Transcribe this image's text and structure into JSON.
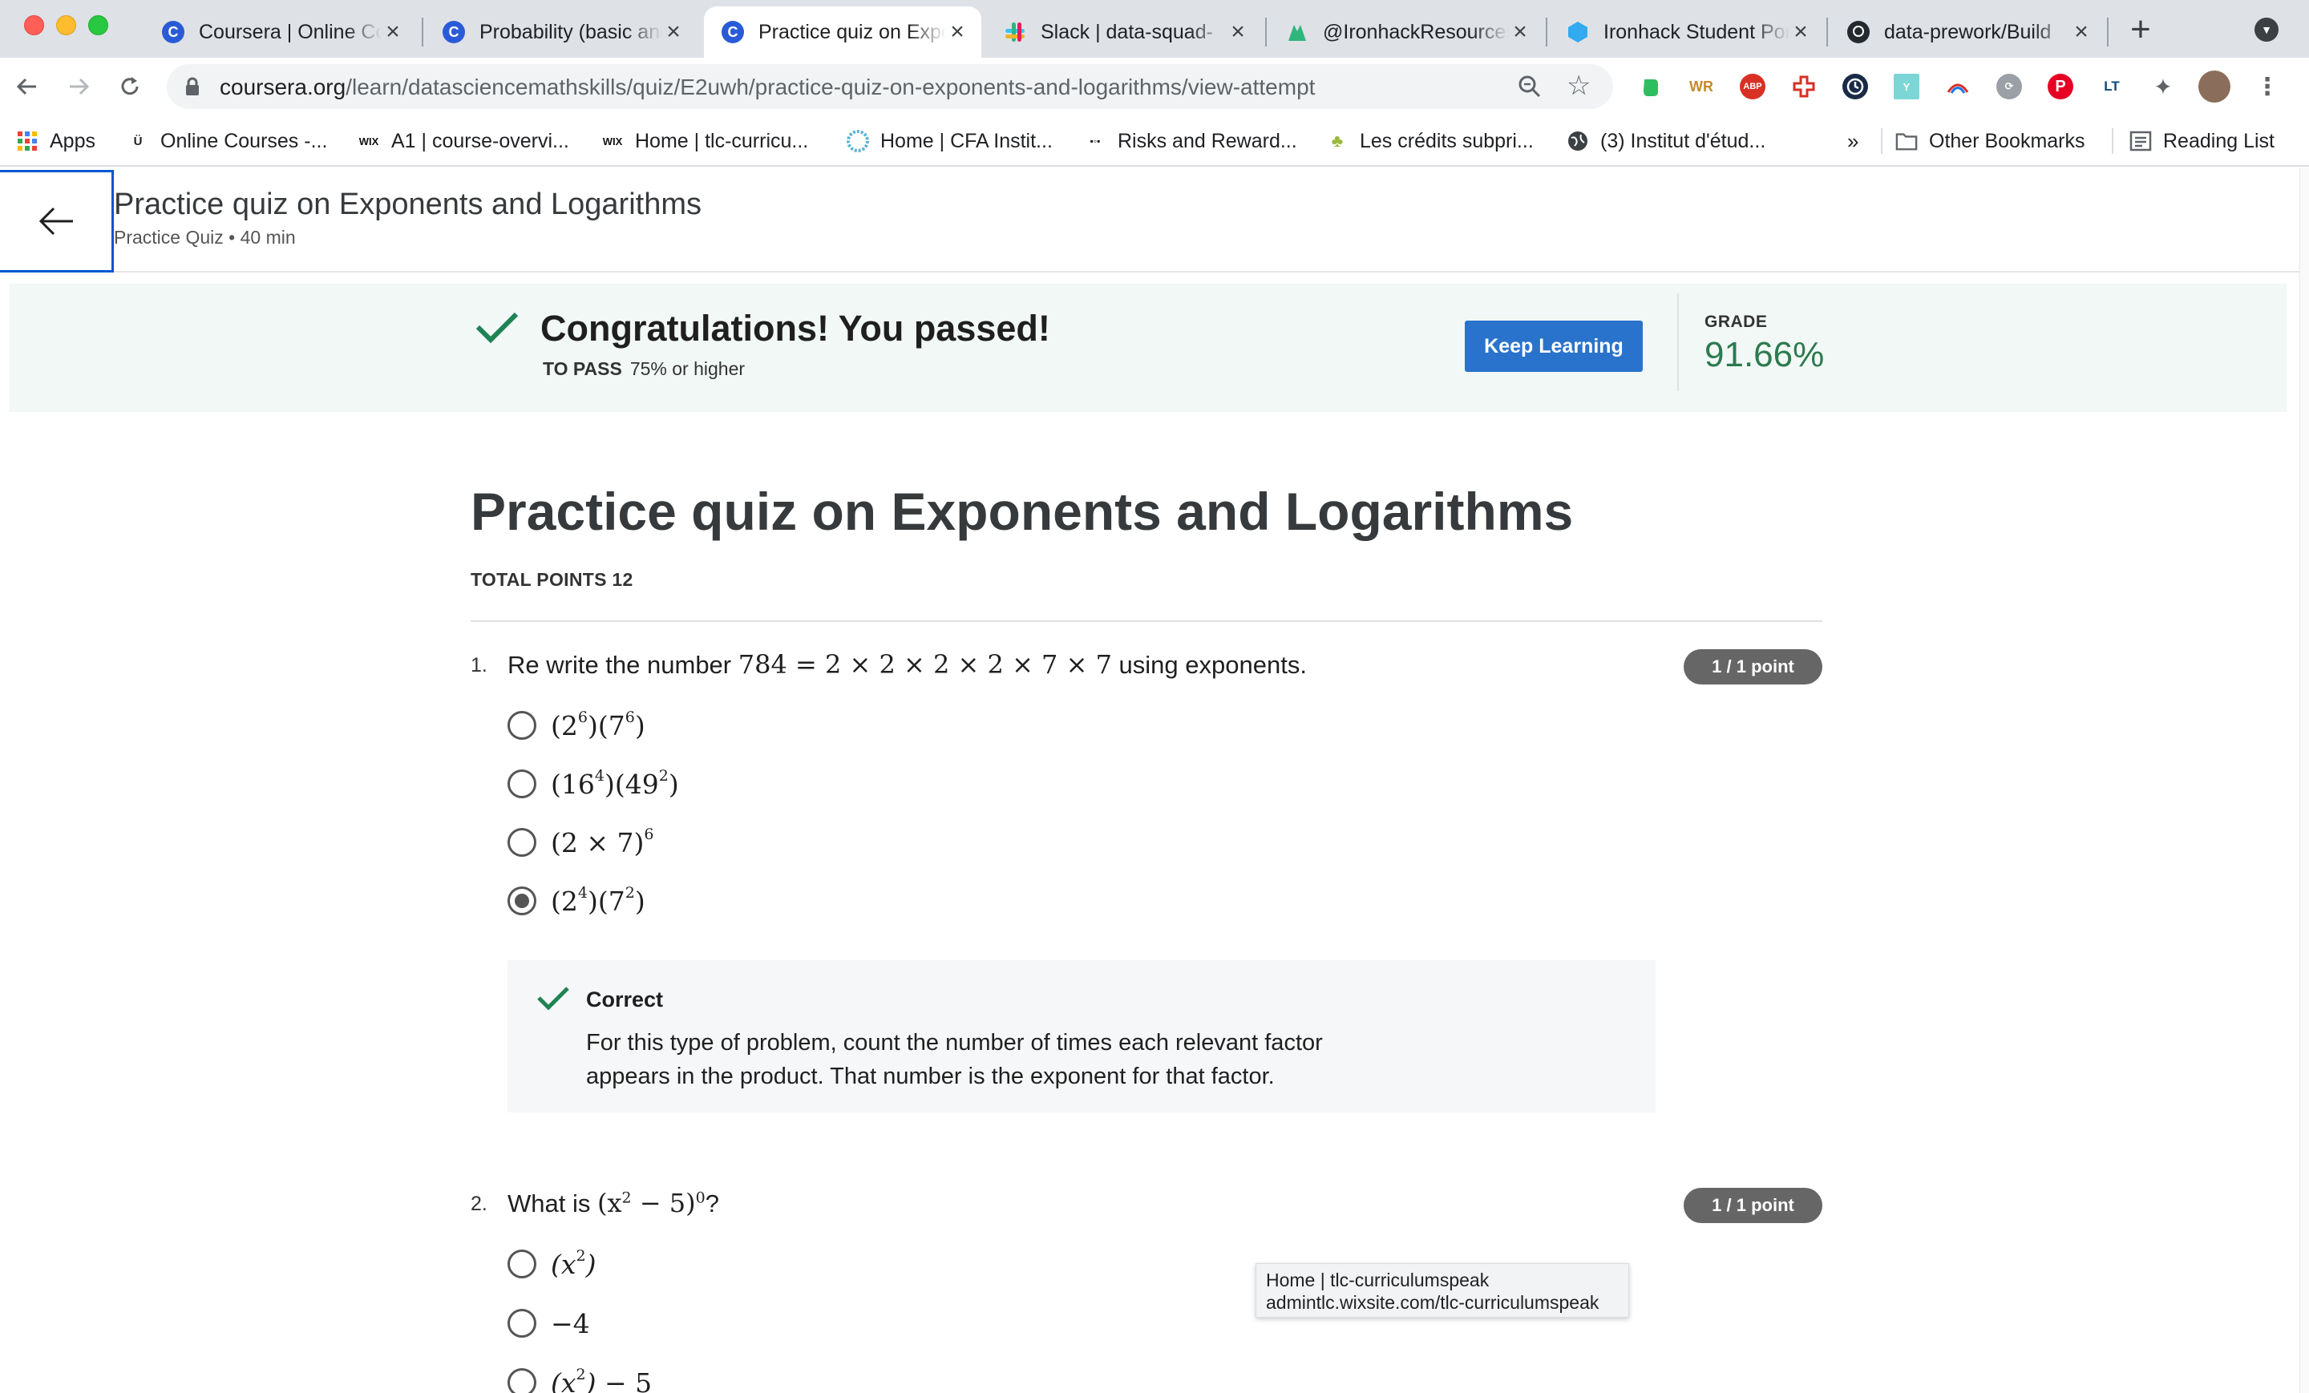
{
  "browser": {
    "tabs": [
      {
        "title": "Coursera | Online Courses",
        "favicon": "coursera-icon",
        "active": false
      },
      {
        "title": "Probability (basic and advanced)",
        "favicon": "coursera-icon",
        "active": false
      },
      {
        "title": "Practice quiz on Exponents and Logarithms",
        "favicon": "coursera-icon",
        "active": true
      },
      {
        "title": "Slack | data-squad-",
        "favicon": "slack-icon",
        "active": false
      },
      {
        "title": "@IronhackResources",
        "favicon": "ironhack-icon",
        "active": false
      },
      {
        "title": "Ironhack Student Portal",
        "favicon": "ironhack-portal-icon",
        "active": false
      },
      {
        "title": "data-prework/Build",
        "favicon": "github-icon",
        "active": false
      }
    ],
    "url_host": "coursera.org",
    "url_path": "/learn/datasciencemathskills/quiz/E2uwh/practice-quiz-on-exponents-and-logarithms/view-attempt",
    "bookmarks": [
      {
        "label": "Apps",
        "icon": "apps-grid-icon"
      },
      {
        "label": "Online Courses -...",
        "icon": "udemy-icon"
      },
      {
        "label": "A1 | course-overvi...",
        "icon": "wix-icon"
      },
      {
        "label": "Home | tlc-curricu...",
        "icon": "wix-icon"
      },
      {
        "label": "Home | CFA Instit...",
        "icon": "cfa-icon"
      },
      {
        "label": "Risks and Reward...",
        "icon": "bookmark-site-icon"
      },
      {
        "label": "Les crédits subpri...",
        "icon": "palm-icon"
      },
      {
        "label": "(3) Institut d'étud...",
        "icon": "globe-icon"
      }
    ],
    "overflow": "»",
    "other_bookmarks": "Other Bookmarks",
    "reading_list": "Reading List",
    "tooltip": {
      "line1": "Home | tlc-curriculumspeak",
      "line2": "admintlc.wixsite.com/tlc-curriculumspeak"
    }
  },
  "header": {
    "title": "Practice quiz on Exponents and Logarithms",
    "subtitle": "Practice Quiz • 40 min"
  },
  "banner": {
    "title": "Congratulations! You passed!",
    "to_pass_label": "TO PASS",
    "to_pass_value": "75% or higher",
    "button": "Keep Learning",
    "grade_label": "GRADE",
    "grade_value": "91.66%"
  },
  "quiz": {
    "title": "Practice quiz on Exponents and Logarithms",
    "total_points": "TOTAL POINTS 12",
    "questions": [
      {
        "number": "1.",
        "prefix": "Re write the number",
        "math": "784 = 2 × 2 × 2 × 2 × 7 × 7",
        "suffix": "using exponents.",
        "points": "1 / 1 point",
        "options": [
          "(2^6)(7^6)",
          "(16^4)(49^2)",
          "(2 × 7)^6",
          "(2^4)(7^2)"
        ],
        "selected": 3,
        "feedback": {
          "title": "Correct",
          "text": "For this type of problem, count the number of times each relevant factor appears in the product. That number is the exponent for that factor."
        }
      },
      {
        "number": "2.",
        "prefix": "What is",
        "math": "(x^2 − 5)^0",
        "suffix": "?",
        "points": "1 / 1 point",
        "options": [
          "(x^2)",
          "−4",
          "(x^2) − 5"
        ]
      }
    ]
  }
}
